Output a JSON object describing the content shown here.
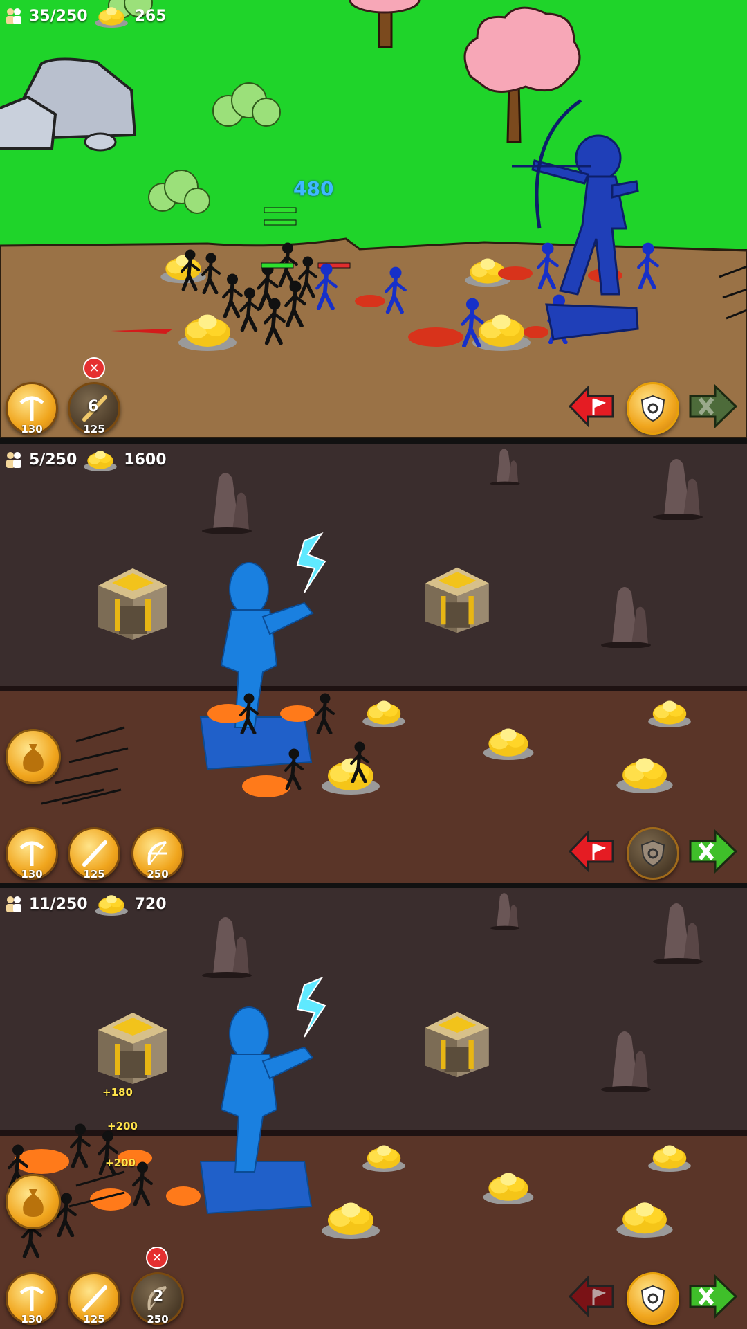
{
  "panels": [
    {
      "population": "35/250",
      "gold": "265",
      "damage_popup": "480",
      "units": [
        {
          "name": "miner",
          "cost": "130"
        },
        {
          "name": "swordwrath",
          "cost": "125",
          "queue": "6"
        }
      ],
      "controls": [
        "attack-flag",
        "defend-shield",
        "garrison"
      ]
    },
    {
      "population": "5/250",
      "gold": "1600",
      "units": [
        {
          "name": "miner",
          "cost": "130"
        },
        {
          "name": "swordwrath",
          "cost": "125"
        },
        {
          "name": "archidon",
          "cost": "250"
        }
      ],
      "controls": [
        "attack-flag",
        "defend-shield",
        "garrison"
      ]
    },
    {
      "population": "11/250",
      "gold": "720",
      "gold_popups": [
        "+180",
        "+200",
        "+200"
      ],
      "units": [
        {
          "name": "miner",
          "cost": "130"
        },
        {
          "name": "swordwrath",
          "cost": "125"
        },
        {
          "name": "archidon",
          "cost": "250",
          "queue": "2"
        }
      ],
      "controls": [
        "attack-flag",
        "defend-shield",
        "garrison"
      ]
    }
  ],
  "colors": {
    "grass": "#1fd42a",
    "dirt": "#9a7246",
    "cave_wall": "#3a2d2d",
    "cave_floor": "#5a3528",
    "gold_button": "#f0a51d",
    "flag_red": "#e51c23",
    "garrison_green": "#3fbf2a"
  },
  "icons": [
    "population-icon",
    "gold-pile-icon",
    "pickaxe-icon",
    "sword-icon",
    "bow-icon",
    "gold-sack-icon",
    "flag-icon",
    "shield-icon",
    "crossed-swords-icon",
    "close-icon"
  ]
}
